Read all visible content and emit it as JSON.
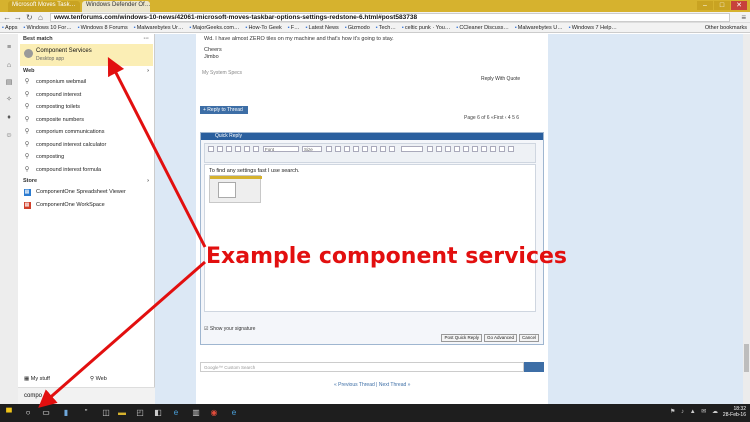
{
  "browser": {
    "tabs": [
      "Microsoft Moves Task…",
      "Windows Defender Of…"
    ],
    "url": "www.tenforums.com/windows-10-news/42061-microsoft-moves-taskbar-options-settings-redstone-6.html#post583738",
    "bookmarks": [
      "Apps",
      "Windows 10 For…",
      "Windows 8 Forums",
      "Malwarebytes Ur…",
      "MajorGeeks.com…",
      "How-To Geek",
      "F…",
      "Latest News",
      "Gizmodo",
      "Tech…",
      "celtic punk · You…",
      "CCleaner Discuss…",
      "Malwarebytes U…",
      "Windows 7 Help…"
    ],
    "other_bookmarks": "Other bookmarks"
  },
  "forum": {
    "post_line1": "Wd. I have almost ZERO tiles on my machine and that's how it's going to stay.",
    "post_line2": "Cheers",
    "post_line3": "Jimbo",
    "system_specs": "My System Specs",
    "reply_with_quote": "Reply With Quote",
    "reply_to_thread": "+ Reply to Thread",
    "pager": "Page 6 of 6  «First  ‹  4  5  6",
    "quick_reply": "Quick Reply",
    "font_select": "Font",
    "size_select": "Size",
    "editor_text": "To find any settings fast I use search.",
    "show_signature": "Show your signature",
    "btn_post": "Post Quick Reply",
    "btn_advanced": "Go Advanced",
    "btn_cancel": "Cancel",
    "search_placeholder": "Google™ Custom Search",
    "thread_nav": "« Previous Thread | Next Thread »"
  },
  "start_panel": {
    "best_match_label": "Best match",
    "best_match_title": "Component Services",
    "best_match_sub": "Desktop app",
    "web_label": "Web",
    "web_items": [
      "componium webmail",
      "compound interest",
      "composting toilets",
      "composite numbers",
      "comporium communications",
      "compound interest calculator",
      "composting",
      "compound interest formula"
    ],
    "store_label": "Store",
    "store_items": [
      "ComponentOne Spreadsheet Viewer",
      "ComponentOne WorkSpace"
    ],
    "my_stuff": "My stuff",
    "web_tab": "Web",
    "query": "compo"
  },
  "annotation": "Example component services",
  "clock": {
    "time": "18:32",
    "date": "28-Feb-16"
  },
  "colors": {
    "annotation": "#e20f0f",
    "best_match_bg": "#fbeeb5",
    "tab_accent": "#d6b22e"
  }
}
